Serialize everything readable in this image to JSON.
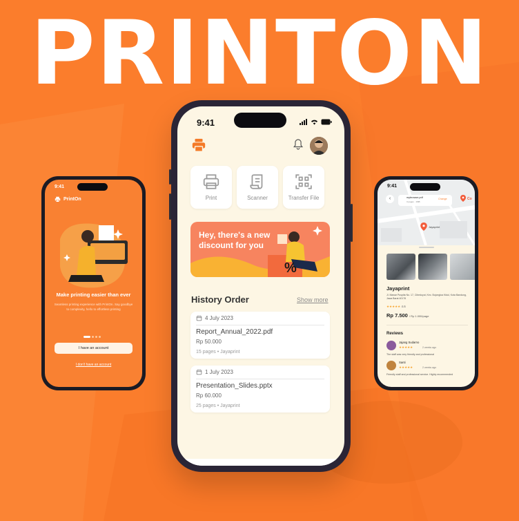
{
  "brand": "PRINTON",
  "colors": {
    "accent": "#fb7d2c",
    "screen_bg": "#fdf6e4",
    "banner": "#f7845f"
  },
  "center_phone": {
    "status_time": "9:41",
    "services": [
      {
        "label": "Print",
        "icon": "printer-icon"
      },
      {
        "label": "Scanner",
        "icon": "scroll-icon"
      },
      {
        "label": "Transfer File",
        "icon": "qr-scan-icon"
      }
    ],
    "banner_text": "Hey, there's a new discount for you",
    "banner_symbol": "%",
    "history": {
      "title": "History Order",
      "show_more": "Show more",
      "orders": [
        {
          "date": "4 July 2023",
          "name": "Report_Annual_2022.pdf",
          "price": "Rp 50.000",
          "meta": "15 pages • Jayaprint"
        },
        {
          "date": "1 July 2023",
          "name": "Presentation_Slides.pptx",
          "price": "Rp 60.000",
          "meta": "25 pages • Jayaprint"
        }
      ]
    }
  },
  "left_phone": {
    "status_time": "9:41",
    "app_name": "PrintOn",
    "headline": "Make printing easier than ever",
    "subtext": "Seamless printing experience with PrintOn. Say goodbye to complexity, hello to effortless printing",
    "primary_button": "I have an account",
    "secondary_link": "I don't have an account"
  },
  "right_phone": {
    "status_time": "9:41",
    "file_name": "mybrowse.pdf",
    "file_meta": "3 pages · 1MB",
    "change_label": "Change",
    "map_pin_label": "Jayaprint",
    "map_pin_label_2": "Co",
    "shop_name": "Jayaprint",
    "address": "Jl. Mawar Puspita No. 17, Cibeduyut, Kec. Bojongloa Kidul, Kota Bandung, Jawa Barat 40176",
    "rating": "4.6",
    "price": "Rp 7.500",
    "price_unit": "/ Rp 1.000/page",
    "reviews_title": "Reviews",
    "reviews": [
      {
        "name": "Jajang Sudarno",
        "when": "2 weeks ago",
        "comment": "The staff was very friendly and professional"
      },
      {
        "name": "Santi",
        "when": "2 weeks ago",
        "comment": "Friendly staff and professional service. Highly recommended"
      }
    ]
  }
}
